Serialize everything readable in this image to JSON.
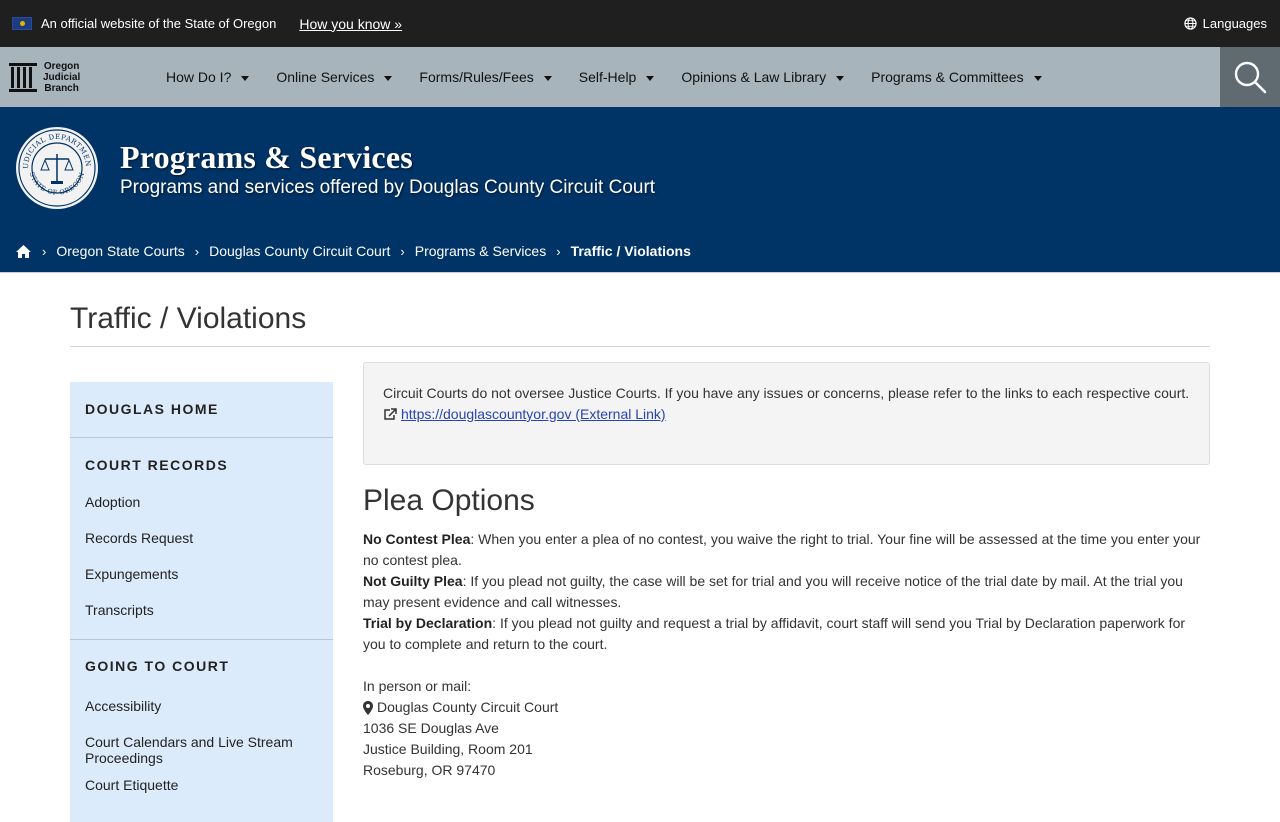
{
  "gov_banner": {
    "text": "An official website of the State of Oregon",
    "how_you_know": "How you know »",
    "languages": "Languages"
  },
  "logo": {
    "line1": "Oregon",
    "line2": "Judicial",
    "line3": "Branch"
  },
  "nav": {
    "items": [
      "How Do I?",
      "Online Services",
      "Forms/Rules/Fees",
      "Self-Help",
      "Opinions & Law Library",
      "Programs & Committees"
    ]
  },
  "hero": {
    "seal_text_top": "JUDICIAL DEPARTMENT",
    "seal_text_bottom": "STATE OF OREGON",
    "title": "Programs & Services",
    "subtitle": "Programs and services offered by Douglas County Circuit Court"
  },
  "breadcrumb": {
    "items": [
      "Oregon State Courts",
      "Douglas County Circuit Court",
      "Programs & Services"
    ],
    "current": "Traffic / Violations"
  },
  "page": {
    "title": "Traffic / Violations"
  },
  "sidebar": {
    "home": "DOUGLAS HOME",
    "court_records": {
      "heading": "COURT RECORDS",
      "items": [
        "Adoption",
        "Records Request",
        "Expungements",
        "Transcripts"
      ]
    },
    "going_to_court": {
      "heading": "GOING TO COURT",
      "items": [
        "Accessibility",
        "Court Calendars and Live Stream Proceedings",
        "Court Etiquette"
      ]
    }
  },
  "notice": {
    "text": "Circuit Courts do not oversee Justice Courts. If you have any issues or concerns, please refer to the links to each respective court.",
    "link": "https://douglascountyor.gov (External Link)"
  },
  "content": {
    "heading": "Plea Options",
    "pleas": [
      {
        "label": "No Contest Plea",
        "text": ":  When you enter a plea of no contest, you waive the right to trial. Your fine will be assessed at the time you enter your no contest plea."
      },
      {
        "label": "Not Guilty Plea",
        "text": ":  If you plead not guilty, the case will be set for trial and you will receive notice of the trial date by mail. At the trial you may present evidence and call witnesses."
      },
      {
        "label": "Trial by Declaration",
        "text": ":  If you plead not guilty and request a trial by affidavit, court staff will send you Trial by Declaration paperwork for you to complete and return to the court."
      }
    ],
    "address": {
      "intro": "In person or mail:",
      "name": "Douglas County Circuit Court",
      "street": "1036 SE Douglas Ave",
      "building": "Justice Building, Room 201",
      "city": "Roseburg, OR 97470"
    }
  },
  "colors": {
    "banner_bg": "#1f1f1f",
    "nav_bg": "#a7b4bb",
    "search_bg": "#5f6b71",
    "hero_bg": "#003366",
    "sidebar_bg": "#dcebfb",
    "link": "#2744b4"
  }
}
